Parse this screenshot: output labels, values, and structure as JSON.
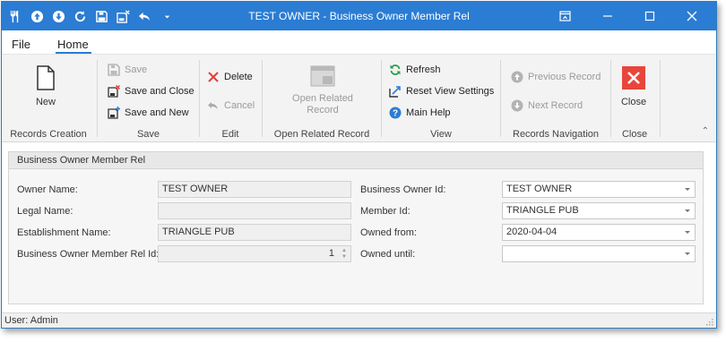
{
  "window": {
    "title": "TEST OWNER - Business Owner Member Rel"
  },
  "quick_access": [
    "utensils-icon",
    "arrow-up-icon",
    "arrow-down-icon",
    "refresh-icon",
    "save-icon",
    "save-close-icon",
    "undo-icon",
    "dropdown-icon"
  ],
  "menu": {
    "file": "File",
    "home": "Home"
  },
  "ribbon": {
    "records_creation": {
      "new_label": "New",
      "group_label": "Records Creation"
    },
    "save": {
      "save": "Save",
      "save_and_close": "Save and Close",
      "save_and_new": "Save and New",
      "group_label": "Save"
    },
    "edit": {
      "delete": "Delete",
      "cancel": "Cancel",
      "group_label": "Edit"
    },
    "open_related": {
      "button_line1": "Open Related",
      "button_line2": "Record",
      "group_label": "Open Related Record"
    },
    "view": {
      "refresh": "Refresh",
      "reset_view_settings": "Reset View Settings",
      "main_help": "Main Help",
      "group_label": "View"
    },
    "navigation": {
      "previous_record": "Previous Record",
      "next_record": "Next Record",
      "group_label": "Records Navigation"
    },
    "close": {
      "close_label": "Close",
      "group_label": "Close"
    }
  },
  "form": {
    "header": "Business Owner Member Rel",
    "owner_name": {
      "label": "Owner Name:",
      "value": "TEST OWNER"
    },
    "legal_name": {
      "label": "Legal Name:",
      "value": ""
    },
    "establishment_name": {
      "label": "Establishment Name:",
      "value": "TRIANGLE PUB"
    },
    "rel_id": {
      "label": "Business Owner Member Rel Id:",
      "value": "1"
    },
    "business_owner_id": {
      "label": "Business Owner Id:",
      "value": "TEST OWNER"
    },
    "member_id": {
      "label": "Member Id:",
      "value": "TRIANGLE PUB"
    },
    "owned_from": {
      "label": "Owned from:",
      "value": "2020-04-04"
    },
    "owned_until": {
      "label": "Owned until:",
      "value": ""
    }
  },
  "status": {
    "user": "User: Admin"
  },
  "colors": {
    "title_bar": "#2b7cd3",
    "close_button": "#e8453c",
    "accent_green": "#2e9e47",
    "accent_blue": "#2b7cd3"
  }
}
